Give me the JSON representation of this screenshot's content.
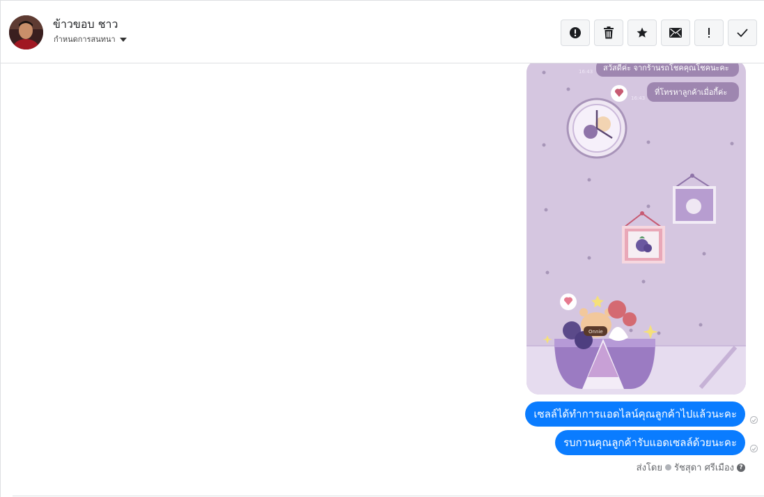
{
  "header": {
    "contact_name": "ข้าวขอบ ชาว",
    "assign_label": "กำหนดการสนทนา",
    "actions": [
      {
        "icon": "alert-circle-icon",
        "name": "report-button"
      },
      {
        "icon": "trash-icon",
        "name": "delete-button"
      },
      {
        "icon": "star-icon",
        "name": "star-button"
      },
      {
        "icon": "envelope-icon",
        "name": "mark-unread-button"
      },
      {
        "icon": "exclamation-icon",
        "name": "follow-up-button"
      },
      {
        "icon": "check-icon",
        "name": "mark-done-button"
      }
    ]
  },
  "attachment": {
    "line1_time": "16:43",
    "line1_text": "สวัสดีค่ะ จากร้านรถโชคคุณโชคนะคะ",
    "line2_time": "16:43",
    "line2_text": "ที่โทรหาลูกค้าเมื่อกี้ค่ะ",
    "cake_text": "Onnie"
  },
  "messages": [
    {
      "text": "เซลล์ได้ทำการแอดไลน์คุณลูกค้าไปแล้วนะคะ"
    },
    {
      "text": "รบกวนคุณลูกค้ารับแอดเซลล์ด้วยนะคะ"
    }
  ],
  "footer": {
    "sent_by_label": "ส่งโดย",
    "sender_name": "รัชสุดา ศรีเมือง"
  },
  "colors": {
    "bubble": "#0a7cff",
    "wallpaper": "#d5c6e0"
  }
}
